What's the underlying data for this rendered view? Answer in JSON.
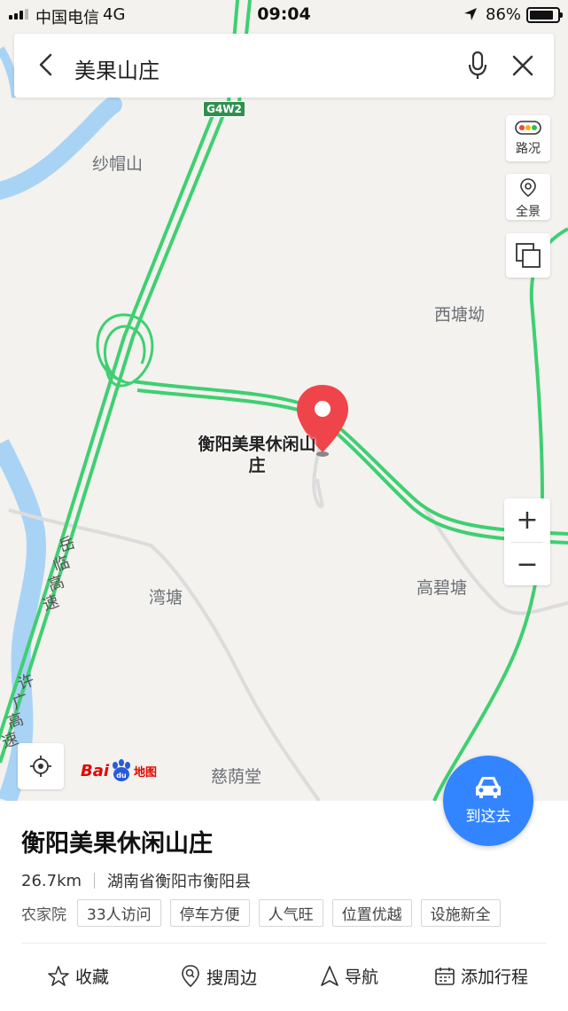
{
  "status_bar": {
    "carrier": "中国电信",
    "network": "4G",
    "time": "09:04",
    "battery": "86%",
    "battery_level": 0.86
  },
  "search": {
    "query": "美果山庄"
  },
  "map": {
    "road_shield": "G4W2",
    "labels": {
      "shamaoshan": "纱帽山",
      "xitangao": "西塘坳",
      "wantang": "湾塘",
      "gaobitang": "高碧塘",
      "ciyintang": "慈荫堂"
    },
    "road_names": {
      "yuelin": [
        "岳",
        "临",
        "高",
        "速"
      ],
      "xuguang": [
        "许",
        "广",
        "高",
        "速"
      ]
    },
    "poi_name": "衡阳美果休闲山庄",
    "controls": {
      "traffic": "路况",
      "panorama": "全景",
      "zoom_in": "+",
      "zoom_out": "−"
    },
    "logo": {
      "bai": "Bai",
      "du": "du",
      "ditu": "地图"
    },
    "goto_label": "到这去"
  },
  "place": {
    "name": "衡阳美果休闲山庄",
    "distance": "26.7km",
    "address": "湖南省衡阳市衡阳县",
    "category": "农家院",
    "tags": [
      "33人访问",
      "停车方便",
      "人气旺",
      "位置优越",
      "设施新全"
    ]
  },
  "actions": {
    "favorite": "收藏",
    "nearby": "搜周边",
    "navigate": "导航",
    "add_trip": "添加行程"
  },
  "colors": {
    "accent": "#3385ff",
    "marker": "#f0444b",
    "road": "#3fcf72",
    "water": "#a9d3f5"
  }
}
